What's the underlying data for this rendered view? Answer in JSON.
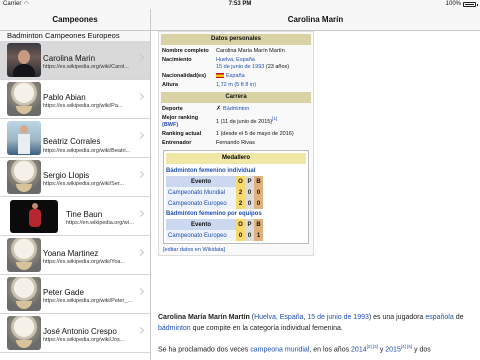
{
  "status": {
    "carrier": "Carrier",
    "wifi": "wifi",
    "time": "7:53 PM",
    "battery": "100%"
  },
  "master": {
    "title": "Campeones",
    "section": "Badminton Campeones Europeos",
    "items": [
      {
        "name": "Carolina Marin",
        "url": "https://es.wikipedia.org/wiki/Carol...",
        "thumb": "photo-icon",
        "selected": true
      },
      {
        "name": "Pablo Abian",
        "url": "https://es.wikipedia.org/wiki/Pa...",
        "thumb": "shuttlecock-icon"
      },
      {
        "name": "Beatriz Corrales",
        "url": "https://es.wikipedia.org/wiki/Beatri...",
        "thumb": "photo-icon"
      },
      {
        "name": "Sergio Llopis",
        "url": "https://es.wikipedia.org/wiki/Ser...",
        "thumb": "shuttlecock-icon"
      },
      {
        "name": "Tine Baun",
        "url": "https://en.wikipedia.org/wiki/...",
        "thumb": "photo-icon"
      },
      {
        "name": "Yoana Martinez",
        "url": "https://es.wikipedia.org/wiki/Yoa...",
        "thumb": "shuttlecock-icon"
      },
      {
        "name": "Peter Gade",
        "url": "https://es.wikipedia.org/wiki/Peter_G...",
        "thumb": "shuttlecock-icon"
      },
      {
        "name": "José Antonio Crespo",
        "url": "https://es.wikipedia.org/wiki/Jos...",
        "thumb": "shuttlecock-icon"
      }
    ]
  },
  "detail": {
    "title": "Carolina Marín",
    "personal_header": "Datos personales",
    "nombre_k": "Nombre completo",
    "nombre_v": "Carolina María Marín Martín",
    "nac_k": "Nacimiento",
    "nac_place": "Huelva, España",
    "nac_date": "15 de junio de 1993",
    "nac_age": " (23 años)",
    "nacionalidad_k": "Nacionalidad(es)",
    "nacionalidad_v": "España",
    "altura_k": "Altura",
    "altura_v": "1,72 m (5 ft 8 in)",
    "carrera_header": "Carrera",
    "deporte_k": "Deporte",
    "deporte_v": "Bádminton",
    "mejor_k": "Mejor ranking",
    "mejor_k2": "(BWF)",
    "mejor_v": "1 (11 de junio de 2015)",
    "mejor_sup": "[1]",
    "actual_k": "Ranking actual",
    "actual_v": "1 (desde el 5 de mayo de 2016)",
    "entrenador_k": "Entrenador",
    "entrenador_v": "Fernando Rivas",
    "medallero": "Medallero",
    "sub1": "Bádminton femenino individual",
    "evento": "Evento",
    "o": "O",
    "p": "P",
    "b": "B",
    "ev1": "Campeonato Mundial",
    "ev1_o": "2",
    "ev1_p": "0",
    "ev1_b": "0",
    "ev2": "Campeonato Europeo",
    "ev2_o": "2",
    "ev2_p": "0",
    "ev2_b": "0",
    "sub2": "Bádminton femenino por equipos",
    "ev3": "Campeonato Europeo",
    "ev3_o": "0",
    "ev3_p": "0",
    "ev3_b": "1",
    "edit": "[editar datos en Wikidata]",
    "p1_bold": "Carolina María Marín Martín",
    "p1_a": " (",
    "p1_link1": "Huelva, España",
    "p1_b": ", ",
    "p1_link2": "15 de junio de 1993",
    "p1_c": ") es una jugadora ",
    "p1_link3": "española",
    "p1_d": " de ",
    "p1_link4": "bádminton",
    "p1_e": " que compite en la categoría individual femenina.",
    "p2_a": "Se ha proclamado dos veces ",
    "p2_link1": "campeona mundial",
    "p2_b": ", en los años ",
    "p2_link2": "2014",
    "p2_sup1": "[2] [3]",
    "p2_c": " y ",
    "p2_link3": "2015",
    "p2_sup2": "[4] [5]",
    "p2_d": " y dos"
  }
}
